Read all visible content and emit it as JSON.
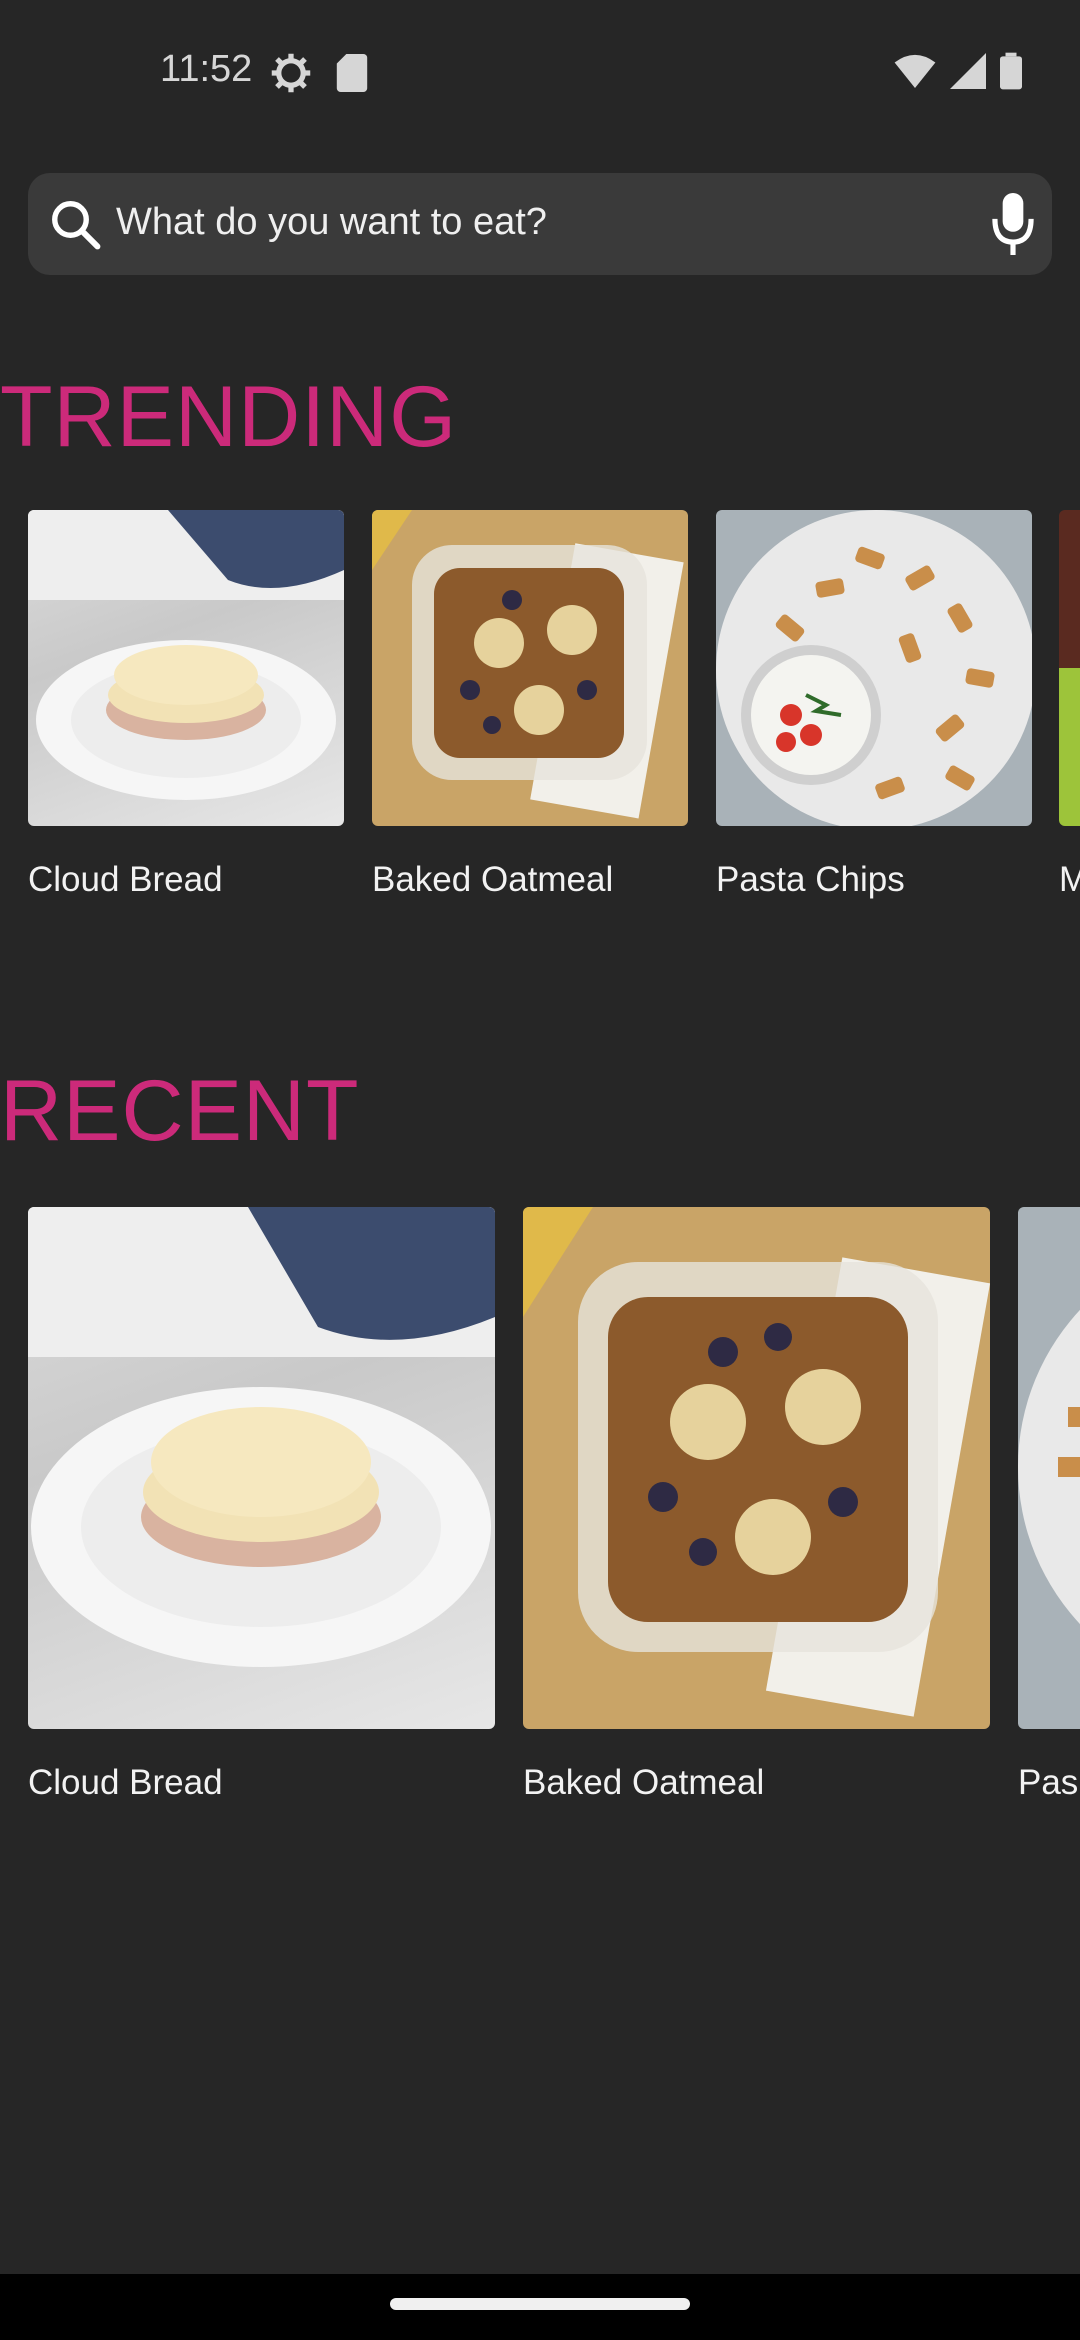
{
  "status_bar": {
    "time": "11:52",
    "icons": [
      "settings-gear-icon",
      "sd-card-icon",
      "wifi-icon",
      "cell-signal-icon",
      "battery-icon"
    ]
  },
  "search": {
    "placeholder": "What do you want to eat?",
    "icons": [
      "search-icon",
      "mic-icon"
    ]
  },
  "sections": {
    "trending": {
      "title": "TRENDING",
      "items": [
        {
          "label": "Cloud Bread"
        },
        {
          "label": "Baked Oatmeal"
        },
        {
          "label": "Pasta Chips"
        },
        {
          "label": "M"
        }
      ]
    },
    "recent": {
      "title": "RECENT",
      "items": [
        {
          "label": "Cloud Bread"
        },
        {
          "label": "Baked Oatmeal"
        },
        {
          "label": "Pas"
        }
      ]
    }
  },
  "colors": {
    "background": "#262626",
    "accent": "#cc2a7a",
    "search_bg": "#3a3a3a"
  }
}
